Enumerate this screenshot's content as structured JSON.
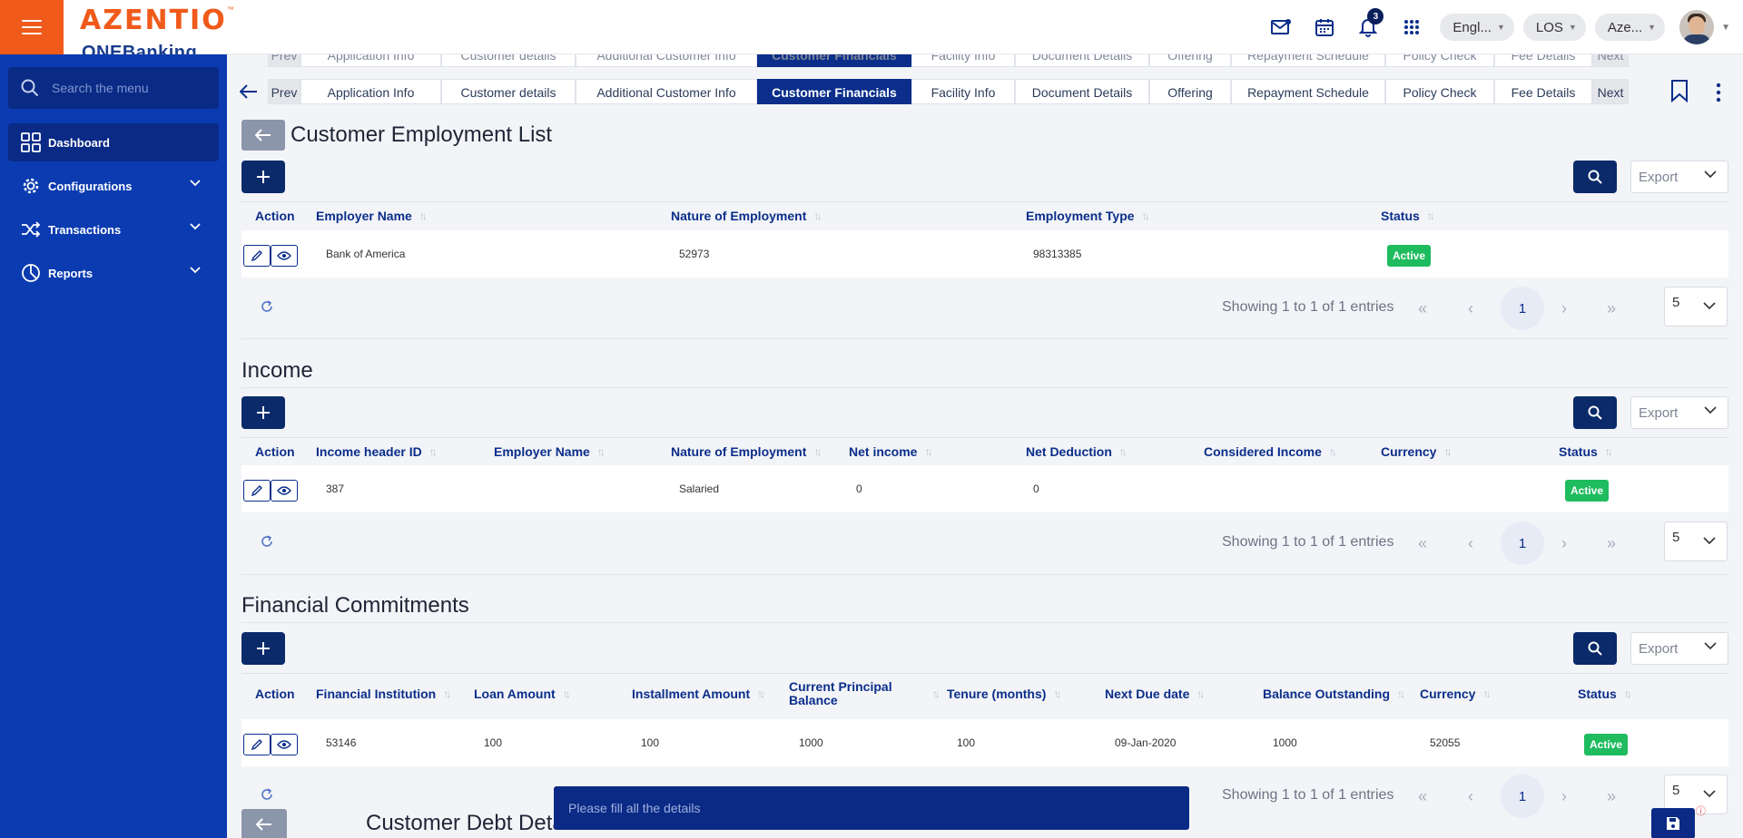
{
  "header": {
    "brand": "AZENTIO",
    "brand_tm": "™",
    "brand_sub": "ONEBanking",
    "notification_count": "3",
    "language": "Engl...",
    "module": "LOS",
    "entity": "Aze..."
  },
  "sidebar": {
    "search_placeholder": "Search the menu",
    "items": [
      {
        "label": "Dashboard",
        "icon": "grid-icon"
      },
      {
        "label": "Configurations",
        "icon": "gear-icon"
      },
      {
        "label": "Transactions",
        "icon": "shuffle-icon"
      },
      {
        "label": "Reports",
        "icon": "pie-chart-icon"
      }
    ]
  },
  "tabs": {
    "prev": "Prev",
    "next": "Next",
    "items": [
      "Application Info",
      "Customer details",
      "Additional Customer Info",
      "Customer Financials",
      "Facility Info",
      "Document Details",
      "Offering",
      "Repayment Schedule",
      "Policy Check",
      "Fee Details"
    ],
    "active": "Customer Financials"
  },
  "employment": {
    "title": "Customer Employment List",
    "export_label": "Export",
    "columns": [
      "Action",
      "Employer Name",
      "Nature of Employment",
      "Employment Type",
      "Status"
    ],
    "rows": [
      {
        "employer_name": "Bank of America",
        "nature": "52973",
        "type": "98313385",
        "status": "Active"
      }
    ],
    "pager": {
      "info": "Showing 1 to 1 of 1 entries",
      "page": "1",
      "page_size": "5"
    }
  },
  "income": {
    "title": "Income",
    "export_label": "Export",
    "columns": [
      "Action",
      "Income header ID",
      "Employer Name",
      "Nature of Employment",
      "Net income",
      "Net Deduction",
      "Considered Income",
      "Currency",
      "Status"
    ],
    "rows": [
      {
        "income_header_id": "387",
        "employer_name": "",
        "nature": "Salaried",
        "net_income": "0",
        "net_deduction": "0",
        "considered_income": "",
        "currency": "",
        "status": "Active"
      }
    ],
    "pager": {
      "info": "Showing 1 to 1 of 1 entries",
      "page": "1",
      "page_size": "5"
    }
  },
  "commitments": {
    "title": "Financial Commitments",
    "export_label": "Export",
    "columns": [
      "Action",
      "Financial Institution",
      "Loan Amount",
      "Installment Amount",
      "Current Principal Balance",
      "Tenure (months)",
      "Next Due date",
      "Balance Outstanding",
      "Currency",
      "Status"
    ],
    "rows": [
      {
        "institution": "53146",
        "loan_amount": "100",
        "installment": "100",
        "principal_balance": "1000",
        "tenure": "100",
        "next_due": "09-Jan-2020",
        "balance_outstanding": "1000",
        "currency": "52055",
        "status": "Active"
      }
    ],
    "pager": {
      "info": "Showing 1 to 1 of 1 entries",
      "page": "1",
      "page_size": "5"
    }
  },
  "debt": {
    "title": "Customer Debt Details"
  },
  "toast": {
    "message": "Please fill all the details"
  },
  "colors": {
    "brand_orange": "#f05a1a",
    "sidebar_blue": "#0b3bb0",
    "primary_navy": "#0a2a6a",
    "status_green": "#1fbc5f"
  }
}
